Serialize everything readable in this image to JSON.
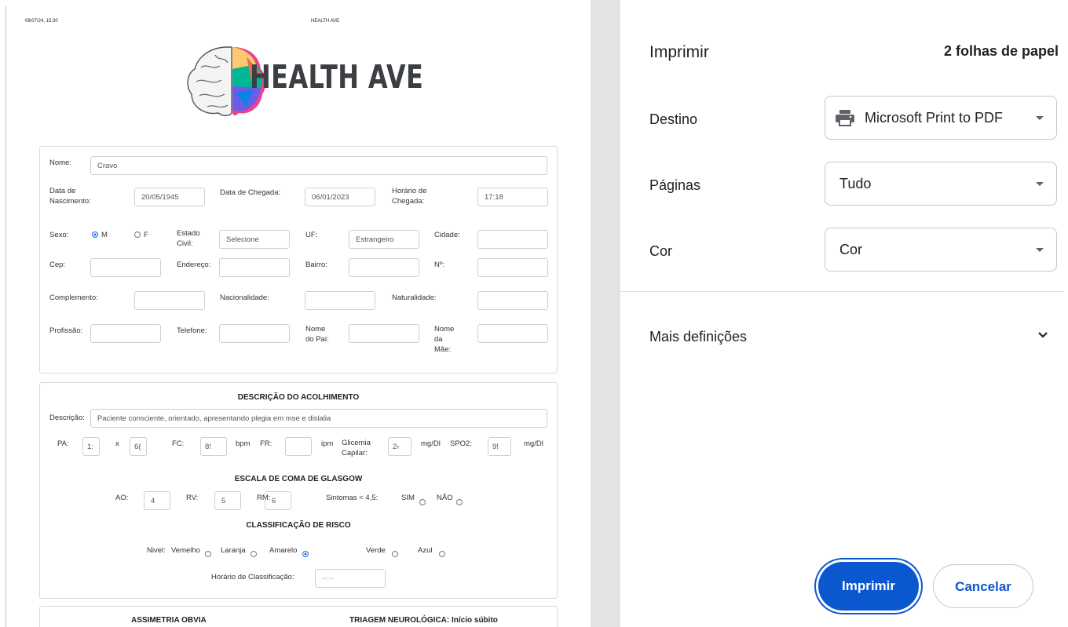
{
  "preview": {
    "header_datetime": "08/07/24, 15:30",
    "header_title": "HEALTH AVE",
    "logo_text": "HEALTH AVE",
    "patient": {
      "nome_label": "Nome:",
      "nome_value": "Cravo",
      "data_nasc_label": "Data de Nascimento:",
      "data_nasc_value": "20/05/1945",
      "data_chegada_label": "Data de Chegada:",
      "data_chegada_value": "06/01/2023",
      "horario_chegada_label": "Horário de Chegada:",
      "horario_chegada_value": "17:18",
      "sexo_label": "Sexo:",
      "sexo_m": "M",
      "sexo_f": "F",
      "estado_civil_label": "Estado Civil:",
      "estado_civil_value": "Selecione",
      "uf_label": "UF:",
      "uf_value": "Estrangeiro",
      "cidade_label": "Cidade:",
      "cep_label": "Cep:",
      "endereco_label": "Endereço:",
      "bairro_label": "Bairro:",
      "numero_label": "Nº:",
      "complemento_label": "Complemento:",
      "nacionalidade_label": "Nacionalidade:",
      "naturalidade_label": "Naturalidade:",
      "profissao_label": "Profissão:",
      "telefone_label": "Telefone:",
      "nome_pai_label": "Nome do Pai:",
      "nome_mae_label": "Nome da Mãe:"
    },
    "acolhimento": {
      "title": "DESCRIÇÃO DO ACOLHIMENTO",
      "descricao_label": "Descrição:",
      "descricao_value": "Paciente consciente, orientado, apresentando plegia em mse e dislalia",
      "pa_label": "PA:",
      "pa_sys": "1:",
      "pa_x": "x",
      "pa_dia": "6(",
      "fc_label": "FC:",
      "fc_value": "8!",
      "bpm": "bpm",
      "fr_label": "FR:",
      "ipm": "ipm",
      "glicemia_label": "Glicemia Capilar:",
      "glicemia_value": "2‹",
      "mgdl1": "mg/Dl",
      "spo2_label": "SPO2:",
      "spo2_value": "9!",
      "mgdl2": "mg/Dl"
    },
    "glasgow": {
      "title": "ESCALA DE COMA DE GLASGOW",
      "ao_label": "AO:",
      "ao_value": "4",
      "rv_label": "RV:",
      "rv_value": "5",
      "rm_label": "RM:",
      "rm_value": "6",
      "sintomas_label": "Sintomas < 4,5:",
      "sim": "SIM",
      "nao": "NÃO"
    },
    "risco": {
      "title": "CLASSIFICAÇÃO DE RISCO",
      "nivel_label": "Nivel:",
      "levels": [
        "Vemelho",
        "Laranja",
        "Amarelo",
        "Verde",
        "Azul"
      ],
      "selected": "Amarelo",
      "horario_label": "Horário de Classificação:",
      "horario_placeholder": "--:--"
    },
    "bottom": {
      "assimetria": "ASSIMETRIA OBVIA",
      "triagem": "TRIAGEM NEUROLÓGICA: Início súbito"
    }
  },
  "settings": {
    "title": "Imprimir",
    "sheets": "2 folhas de papel",
    "destino_label": "Destino",
    "destino_value": "Microsoft Print to PDF",
    "paginas_label": "Páginas",
    "paginas_value": "Tudo",
    "cor_label": "Cor",
    "cor_value": "Cor",
    "mais_definicoes": "Mais definições",
    "print_button": "Imprimir",
    "cancel_button": "Cancelar"
  }
}
